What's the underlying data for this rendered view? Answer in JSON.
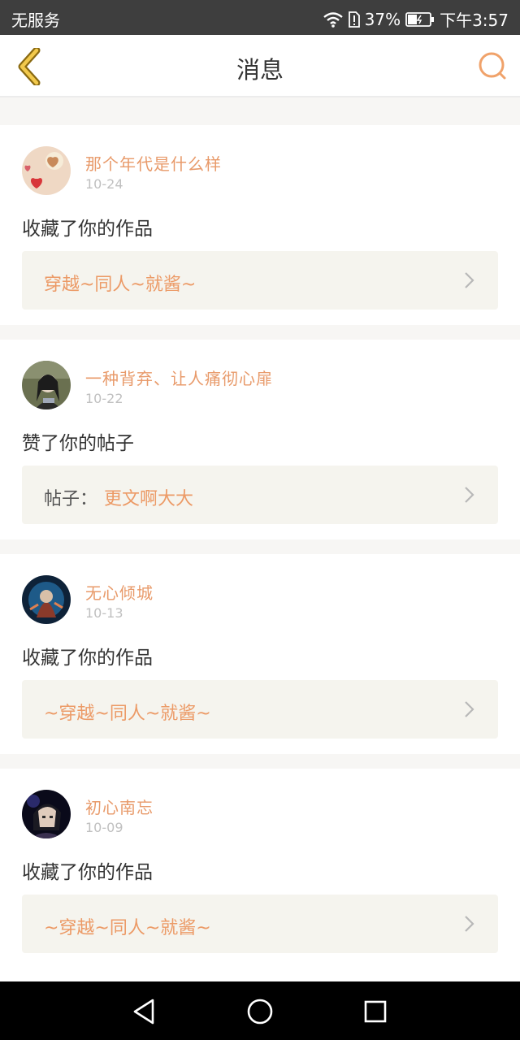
{
  "status": {
    "carrier": "无服务",
    "battery_pct": "37%",
    "time": "下午3:57"
  },
  "header": {
    "title": "消息",
    "back_icon": "chevron-left-icon",
    "search_icon": "search-icon"
  },
  "colors": {
    "accent": "#e89a6a",
    "ref_bg": "#f5f4ee",
    "back_icon": "#c9a12c"
  },
  "notifications": [
    {
      "username": "那个年代是什么样",
      "date": "10-24",
      "action": "收藏了你的作品",
      "ref_prefix": "",
      "ref_title": "穿越~同人~就酱~"
    },
    {
      "username": "一种背弃、让人痛彻心扉",
      "date": "10-22",
      "action": "赞了你的帖子",
      "ref_prefix": "帖子：",
      "ref_title": "更文啊大大"
    },
    {
      "username": "无心倾城",
      "date": "10-13",
      "action": "收藏了你的作品",
      "ref_prefix": "",
      "ref_title": "~穿越~同人~就酱~"
    },
    {
      "username": "初心南忘",
      "date": "10-09",
      "action": "收藏了你的作品",
      "ref_prefix": "",
      "ref_title": "~穿越~同人~就酱~"
    }
  ],
  "nav": {
    "back": "back-triangle-icon",
    "home": "home-circle-icon",
    "recents": "recents-square-icon"
  }
}
